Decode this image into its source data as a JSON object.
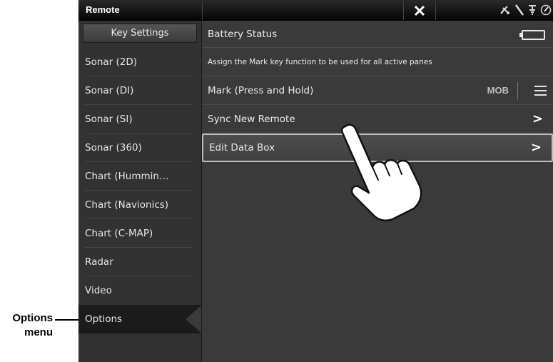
{
  "callout": {
    "line1": "Options",
    "line2": "menu"
  },
  "titlebar": {
    "title": "Remote",
    "close_icon": "close-x-icon",
    "status_icons": [
      "satellite-icon",
      "antenna-icon",
      "gps-icon",
      "compass-icon"
    ]
  },
  "sidebar": {
    "header": "Key Settings",
    "items": [
      {
        "label": "Sonar (2D)"
      },
      {
        "label": "Sonar (DI)"
      },
      {
        "label": "Sonar (SI)"
      },
      {
        "label": "Sonar (360)"
      },
      {
        "label": "Chart (Hummin…"
      },
      {
        "label": "Chart (Navionics)"
      },
      {
        "label": "Chart (C-MAP)"
      },
      {
        "label": "Radar"
      },
      {
        "label": "Video"
      },
      {
        "label": "Options",
        "selected": true
      }
    ]
  },
  "main": {
    "battery_status": "Battery Status",
    "info_text": "Assign the Mark key function to be used for all active panes",
    "mark_label": "Mark (Press and Hold)",
    "mark_value": "MOB",
    "sync_label": "Sync New Remote",
    "edit_label": "Edit Data Box"
  },
  "colors": {
    "screen_bg": "#3a3a3a",
    "sidebar_bg": "#323232",
    "titlebar_bg": "#050505",
    "selected_bg": "#1b1b1b"
  }
}
